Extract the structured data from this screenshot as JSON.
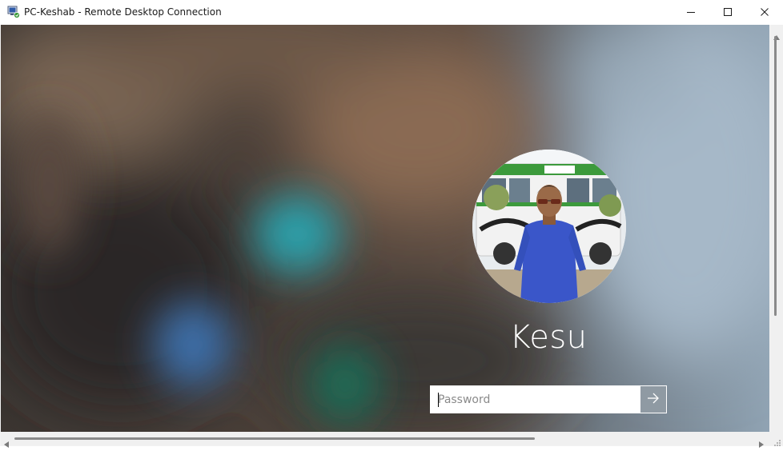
{
  "window": {
    "title": "PC-Keshab - Remote Desktop Connection",
    "app_icon": "remote-desktop-icon",
    "controls": {
      "minimize": "minimize-icon",
      "maximize": "maximize-icon",
      "close": "close-icon"
    }
  },
  "lock_screen": {
    "user_name": "Kesu",
    "avatar": "user-photo",
    "password": {
      "placeholder": "Password",
      "value": ""
    },
    "submit_icon": "arrow-right-icon"
  },
  "colors": {
    "titlebar": "#ffffff",
    "submit_button": "#8f9aa3",
    "text_on_background": "#ffffff"
  }
}
